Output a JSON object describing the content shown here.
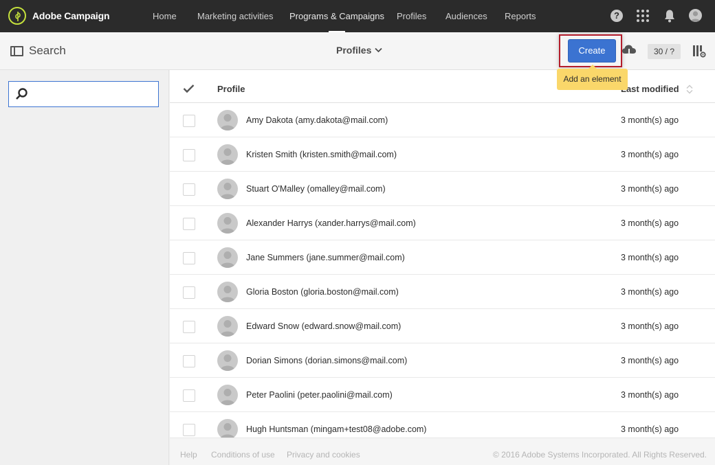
{
  "app": {
    "brand": "Adobe Campaign",
    "accent_color": "#3b73d1",
    "logo_color": "#c5e13c"
  },
  "nav": {
    "items": [
      {
        "label": "Home"
      },
      {
        "label": "Marketing activities"
      },
      {
        "label": "Programs & Campaigns"
      },
      {
        "label": "Profiles"
      },
      {
        "label": "Audiences"
      },
      {
        "label": "Reports"
      }
    ],
    "active": "Programs & Campaigns",
    "help_glyph": "?",
    "icons": [
      "help-icon",
      "apps-icon",
      "bell-icon",
      "user-avatar"
    ]
  },
  "toolbar": {
    "search_label": "Search",
    "view_label": "Profiles",
    "create_label": "Create",
    "create_tooltip": "Add an element",
    "count": "30 / ?",
    "icons": [
      "panel-toggle-icon",
      "chevron-down-icon",
      "cloud-download-icon",
      "column-config-icon"
    ]
  },
  "search": {
    "value": "",
    "placeholder": ""
  },
  "table": {
    "columns": {
      "profile": "Profile",
      "last_modified": "Last modified"
    },
    "rows": [
      {
        "name": "Amy Dakota (amy.dakota@mail.com)",
        "modified": "3 month(s) ago"
      },
      {
        "name": "Kristen Smith (kristen.smith@mail.com)",
        "modified": "3 month(s) ago"
      },
      {
        "name": "Stuart O'Malley (omalley@mail.com)",
        "modified": "3 month(s) ago"
      },
      {
        "name": "Alexander Harrys (xander.harrys@mail.com)",
        "modified": "3 month(s) ago"
      },
      {
        "name": "Jane Summers (jane.summer@mail.com)",
        "modified": "3 month(s) ago"
      },
      {
        "name": "Gloria Boston (gloria.boston@mail.com)",
        "modified": "3 month(s) ago"
      },
      {
        "name": "Edward Snow (edward.snow@mail.com)",
        "modified": "3 month(s) ago"
      },
      {
        "name": "Dorian Simons (dorian.simons@mail.com)",
        "modified": "3 month(s) ago"
      },
      {
        "name": "Peter Paolini (peter.paolini@mail.com)",
        "modified": "3 month(s) ago"
      },
      {
        "name": "Hugh Huntsman (mingam+test08@adobe.com)",
        "modified": "3 month(s) ago"
      }
    ]
  },
  "footer": {
    "help": "Help",
    "conditions": "Conditions of use",
    "privacy": "Privacy and cookies",
    "copyright": "© 2016 Adobe Systems Incorporated. All Rights Reserved."
  }
}
